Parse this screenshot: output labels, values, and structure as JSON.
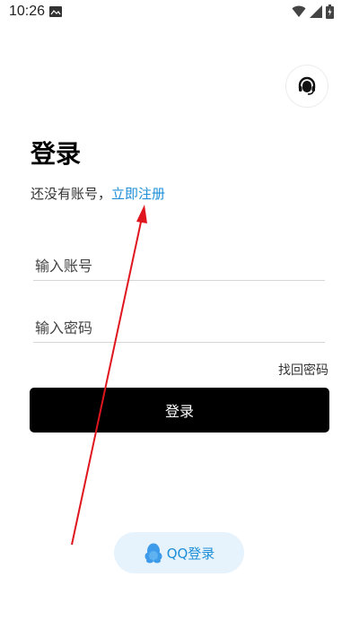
{
  "status_bar": {
    "time": "10:26"
  },
  "login": {
    "title": "登录",
    "no_account_text": "还没有账号，",
    "register_link": "立即注册",
    "account_placeholder": "输入账号",
    "password_placeholder": "输入密码",
    "forgot_password": "找回密码",
    "login_button": "登录",
    "qq_login": "QQ登录"
  },
  "icons": {
    "support": "customer-service-headset-icon",
    "qq": "qq-penguin-icon",
    "notification": "image-notification-icon",
    "wifi": "wifi-icon",
    "signal": "cell-signal-icon",
    "battery": "battery-charging-icon"
  },
  "colors": {
    "link": "#1e8fd8",
    "primary_button": "#000000",
    "qq_button_bg": "#e6f3fd",
    "annotation_arrow": "#e0161e"
  }
}
